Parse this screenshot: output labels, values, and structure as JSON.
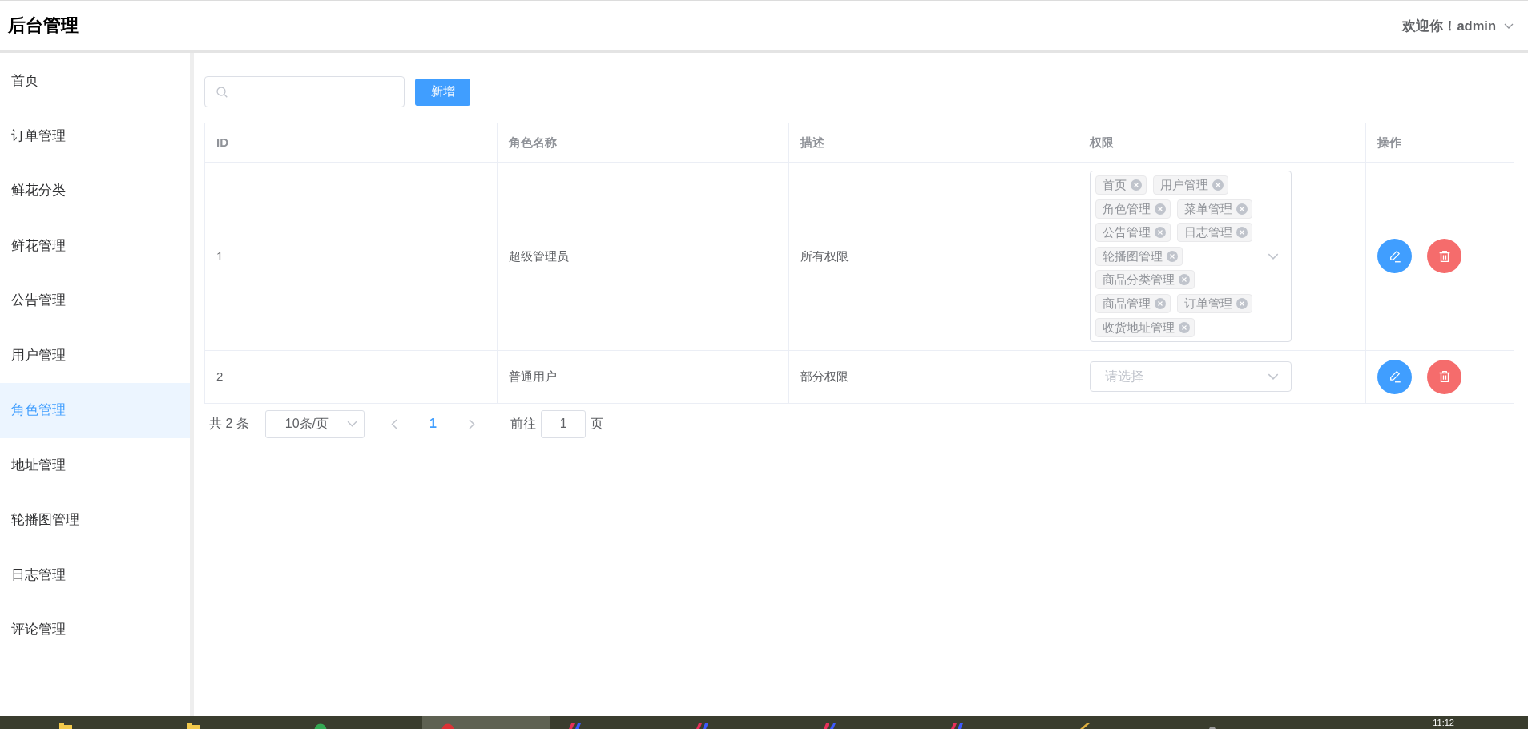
{
  "header": {
    "title": "后台管理",
    "user": "欢迎你！admin"
  },
  "sidebar": {
    "items": [
      {
        "label": "首页",
        "selected": false
      },
      {
        "label": "订单管理",
        "selected": false
      },
      {
        "label": "鲜花分类",
        "selected": false
      },
      {
        "label": "鲜花管理",
        "selected": false
      },
      {
        "label": "公告管理",
        "selected": false
      },
      {
        "label": "用户管理",
        "selected": false
      },
      {
        "label": "角色管理",
        "selected": true
      },
      {
        "label": "地址管理",
        "selected": false
      },
      {
        "label": "轮播图管理",
        "selected": false
      },
      {
        "label": "日志管理",
        "selected": false
      },
      {
        "label": "评论管理",
        "selected": false
      }
    ]
  },
  "toolbar": {
    "add_button": "新增"
  },
  "table": {
    "columns": [
      "ID",
      "角色名称",
      "描述",
      "权限",
      "操作"
    ],
    "rows": [
      {
        "cells": [
          "1",
          "超级管理员",
          "所有权限"
        ],
        "permissions": {
          "tags": [
            "首页",
            "用户管理",
            "角色管理",
            "菜单管理",
            "公告管理",
            "日志管理",
            "轮播图管理",
            "商品分类管理",
            "商品管理",
            "订单管理",
            "收货地址管理"
          ]
        }
      },
      {
        "cells": [
          "2",
          "普通用户",
          "部分权限"
        ],
        "permissions": {
          "placeholder": "请选择"
        }
      }
    ]
  },
  "pagination": {
    "total": "共 2 条",
    "page_size": "10条/页",
    "prev_disabled": true,
    "pages": [
      {
        "label": "1",
        "selected": true
      }
    ],
    "next_disabled": true,
    "jump_label": "前往",
    "jump_value": "1",
    "jump_suffix": "页"
  },
  "taskbar": {
    "apps": [
      {
        "kind": "folder",
        "color": "#f2c94c",
        "selected": false
      },
      {
        "kind": "folder",
        "color": "#f2c94c",
        "selected": false
      },
      {
        "kind": "circle",
        "color": "#34a853",
        "selected": false
      },
      {
        "kind": "circle",
        "color": "#db3236",
        "selected": true
      },
      {
        "kind": "pair",
        "color": "#e8305a",
        "selected": false
      },
      {
        "kind": "pair",
        "color": "#e8305a",
        "selected": false
      },
      {
        "kind": "pair",
        "color": "#e8305a",
        "selected": false
      },
      {
        "kind": "pair",
        "color": "#e8305a",
        "selected": false
      },
      {
        "kind": "slash",
        "color": "#e0b040",
        "selected": false
      },
      {
        "kind": "dot",
        "color": "#9a9a9a",
        "selected": false
      }
    ],
    "clock": "11:12"
  }
}
